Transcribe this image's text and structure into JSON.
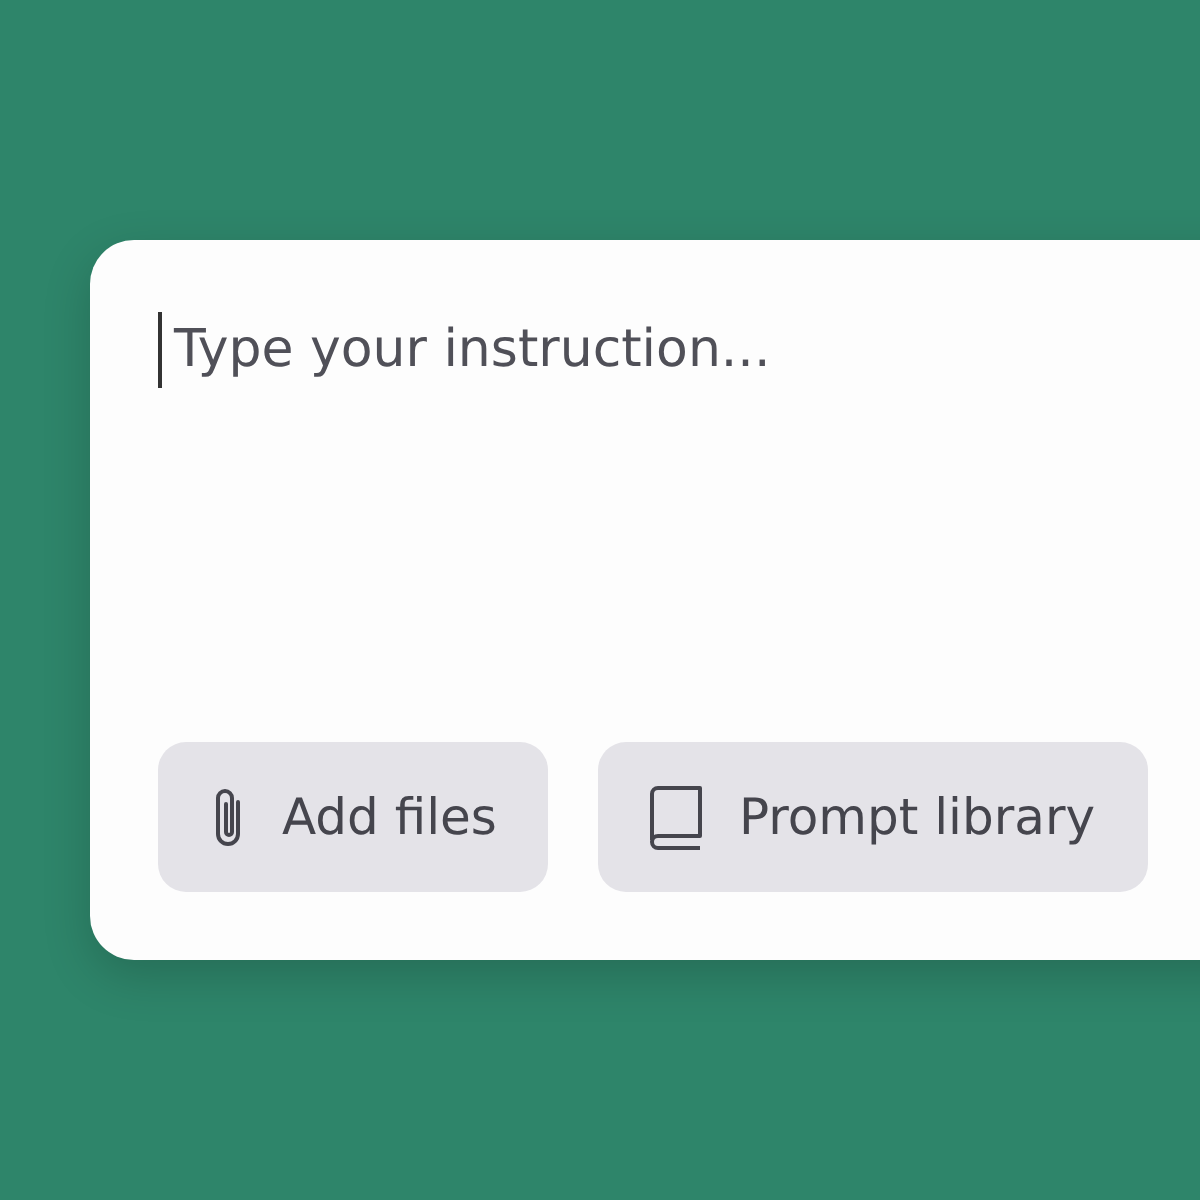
{
  "prompt_box": {
    "placeholder": "Type your instruction..."
  },
  "buttons": [
    {
      "kind": "attach",
      "label": "Add files"
    },
    {
      "kind": "library",
      "label": "Prompt library"
    }
  ]
}
